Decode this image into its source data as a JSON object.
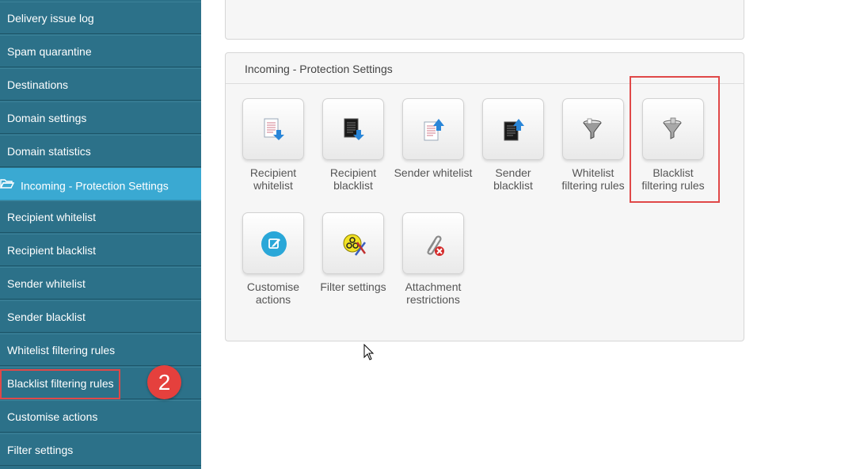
{
  "sidebar": {
    "items": [
      {
        "label": "Delivery issue log"
      },
      {
        "label": "Spam quarantine"
      },
      {
        "label": "Destinations"
      },
      {
        "label": "Domain settings"
      },
      {
        "label": "Domain statistics"
      },
      {
        "label": "Incoming - Protection Settings"
      },
      {
        "label": "Recipient whitelist"
      },
      {
        "label": "Recipient blacklist"
      },
      {
        "label": "Sender whitelist"
      },
      {
        "label": "Sender blacklist"
      },
      {
        "label": "Whitelist filtering rules"
      },
      {
        "label": "Blacklist filtering rules"
      },
      {
        "label": "Customise actions"
      },
      {
        "label": "Filter settings"
      }
    ]
  },
  "badge": "2",
  "panel": {
    "title": "Incoming - Protection Settings",
    "tiles": [
      {
        "label_1": "Recipient",
        "label_2": "whitelist",
        "icon": "recipient-whitelist-icon"
      },
      {
        "label_1": "Recipient",
        "label_2": "blacklist",
        "icon": "recipient-blacklist-icon"
      },
      {
        "label_1": "Sender whitelist",
        "label_2": "",
        "icon": "sender-whitelist-icon"
      },
      {
        "label_1": "Sender",
        "label_2": "blacklist",
        "icon": "sender-blacklist-icon"
      },
      {
        "label_1": "Whitelist",
        "label_2": "filtering rules",
        "icon": "whitelist-funnel-icon"
      },
      {
        "label_1": "Blacklist",
        "label_2": "filtering rules",
        "icon": "blacklist-funnel-icon"
      },
      {
        "label_1": "Customise",
        "label_2": "actions",
        "icon": "edit-icon"
      },
      {
        "label_1": "Filter settings",
        "label_2": "",
        "icon": "biohazard-icon"
      },
      {
        "label_1": "Attachment",
        "label_2": "restrictions",
        "icon": "attachment-blocked-icon"
      }
    ]
  },
  "colors": {
    "sidebar": "#2c7189",
    "sidebar_active": "#3aa9d2",
    "highlight": "#e04848",
    "badge": "#e5403d"
  }
}
